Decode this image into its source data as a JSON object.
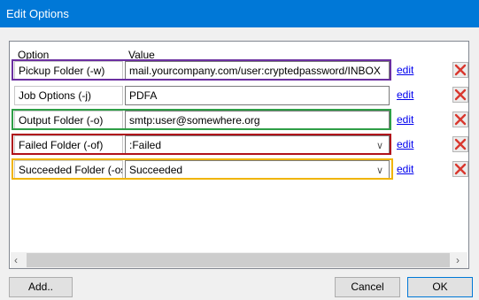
{
  "window": {
    "title": "Edit Options"
  },
  "table": {
    "header_option": "Option",
    "header_value": "Value",
    "rows": [
      {
        "label": "Pickup Folder (-w)",
        "value": "mail.yourcompany.com/user:cryptedpassword/INBOX",
        "dropdown": false,
        "highlight": "#6b2fa0",
        "edit": "edit"
      },
      {
        "label": "Job Options (-j)",
        "value": "PDFA",
        "dropdown": false,
        "highlight": "",
        "edit": "edit"
      },
      {
        "label": "Output Folder (-o)",
        "value": "smtp:user@somewhere.org",
        "dropdown": false,
        "highlight": "#2e9e46",
        "edit": "edit"
      },
      {
        "label": "Failed Folder (-of)",
        "value": ":Failed",
        "dropdown": true,
        "highlight": "#b0121b",
        "edit": "edit"
      },
      {
        "label": "Succeeded Folder (-os)",
        "value": "Succeeded",
        "dropdown": true,
        "highlight": "#f0b400",
        "edit": "edit"
      }
    ]
  },
  "icons": {
    "delete": "delete-x-icon",
    "scroll_left": "scroll-left-icon",
    "scroll_right": "scroll-right-icon",
    "dropdown": "chevron-down-icon"
  },
  "buttons": {
    "add": "Add..",
    "cancel": "Cancel",
    "ok": "OK"
  }
}
